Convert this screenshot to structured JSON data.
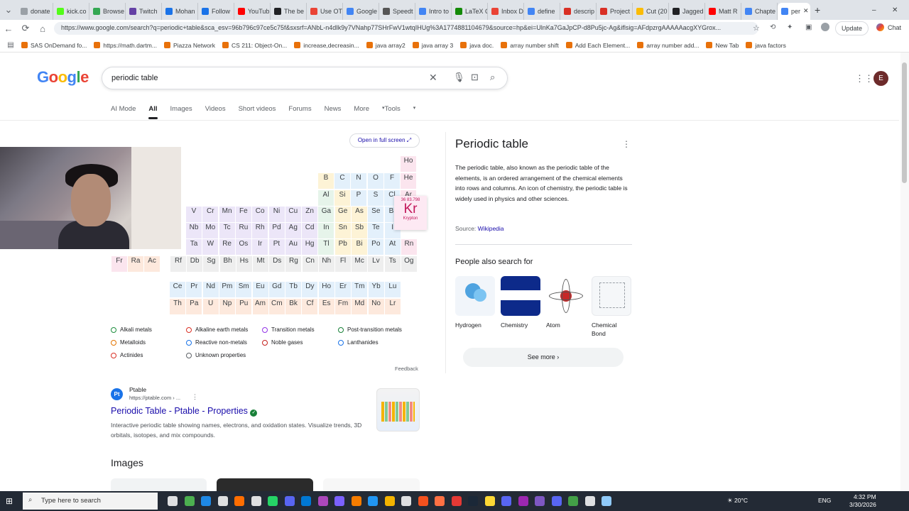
{
  "browser": {
    "tabs": [
      {
        "label": "donate"
      },
      {
        "label": "kick.co"
      },
      {
        "label": "Browse"
      },
      {
        "label": "Twitch"
      },
      {
        "label": "Mohan"
      },
      {
        "label": "Follow"
      },
      {
        "label": "YouTub"
      },
      {
        "label": "The be"
      },
      {
        "label": "Use OT"
      },
      {
        "label": "Google"
      },
      {
        "label": "Speedt"
      },
      {
        "label": "Intro to"
      },
      {
        "label": "LaTeX C"
      },
      {
        "label": "Inbox D"
      },
      {
        "label": "define"
      },
      {
        "label": "descrip"
      },
      {
        "label": "Project"
      },
      {
        "label": "Cut (20"
      },
      {
        "label": "Jagged"
      },
      {
        "label": "Matt R"
      },
      {
        "label": "Chapte"
      },
      {
        "label": "per"
      }
    ],
    "url": "https://www.google.com/search?q=periodic+table&sca_esv=96b796c97ce5c75f&sxsrf=ANbL-n4dIk9y7VNahp77SHrFwV1wtqIHUg%3A1774881104679&source=hp&ei=UlnKa7GaJpCP-d8Pu5jc-Ag&iflsig=AFdpzrgAAAAAacgXYGrox...",
    "update_label": "Update",
    "chat_label": "Chat",
    "bookmarks": [
      "SAS OnDemand fo...",
      "https://math.dartm...",
      "Piazza Network",
      "CS 211: Object-On...",
      "increase,decreasin...",
      "java array2",
      "java array 3",
      "java doc.",
      "array number shift",
      "Add Each Element...",
      "array number add...",
      "New Tab",
      "java factors"
    ]
  },
  "search": {
    "logo": "Google",
    "query": "periodic table",
    "filters": [
      "AI Mode",
      "All",
      "Images",
      "Videos",
      "Short videos",
      "Forums",
      "News",
      "More",
      "Tools"
    ],
    "avatar": "E"
  },
  "periodic": {
    "open_full": "Open in full screen",
    "popup": {
      "number": "36",
      "mass": "83.798",
      "symbol": "Kr",
      "name": "Krypton"
    },
    "rows": [
      [
        "Ho",
        "He"
      ],
      [
        "B",
        "C",
        "N",
        "O",
        "F",
        "Ne"
      ],
      [
        "Al",
        "Si",
        "P",
        "S",
        "Cl",
        "Ar"
      ],
      [
        "V",
        "Cr",
        "Mn",
        "Fe",
        "Co",
        "Ni",
        "Cu",
        "Zn",
        "Ga",
        "Ge",
        "As",
        "Se",
        "Br"
      ],
      [
        "Nb",
        "Mo",
        "Tc",
        "Ru",
        "Rh",
        "Pd",
        "Ag",
        "Cd",
        "In",
        "Sn",
        "Sb",
        "Te",
        "I"
      ],
      [
        "Ta",
        "W",
        "Re",
        "Os",
        "Ir",
        "Pt",
        "Au",
        "Hg",
        "Tl",
        "Pb",
        "Bi",
        "Po",
        "At",
        "Rn"
      ],
      [
        "Fr",
        "Ra",
        "Ac",
        "Rf",
        "Db",
        "Sg",
        "Bh",
        "Hs",
        "Mt",
        "Ds",
        "Rg",
        "Cn",
        "Nh",
        "Fl",
        "Mc",
        "Lv",
        "Ts",
        "Og"
      ],
      [
        "Ce",
        "Pr",
        "Nd",
        "Pm",
        "Sm",
        "Eu",
        "Gd",
        "Tb",
        "Dy",
        "Ho",
        "Er",
        "Tm",
        "Yb",
        "Lu"
      ],
      [
        "Th",
        "Pa",
        "U",
        "Np",
        "Pu",
        "Am",
        "Cm",
        "Bk",
        "Cf",
        "Es",
        "Fm",
        "Md",
        "No",
        "Lr"
      ]
    ],
    "legend": [
      "Alkali metals",
      "Alkaline earth metals",
      "Transition metals",
      "Post-transition metals",
      "Metalloids",
      "Reactive non-metals",
      "Noble gases",
      "Lanthanides",
      "Actinides",
      "Unknown properties"
    ],
    "legend_colors": [
      "#1e8e3e",
      "#d93025",
      "#9334e6",
      "#188038",
      "#e37400",
      "#1a73e8",
      "#c5221f",
      "#1a73e8",
      "#d93025",
      "#5f6368"
    ],
    "feedback": "Feedback"
  },
  "result": {
    "site": "Ptable",
    "url": "https://ptable.com › ...",
    "title": "Periodic Table - Ptable - Properties",
    "snippet": "Interactive periodic table showing names, electrons, and oxidation states. Visualize trends, 3D orbitals, isotopes, and mix compounds."
  },
  "images_heading": "Images",
  "knowledge": {
    "title": "Periodic table",
    "description": "The periodic table, also known as the periodic table of the elements, is an ordered arrangement of the chemical elements into rows and columns. An icon of chemistry, the periodic table is widely used in physics and other sciences.",
    "source_label": "Source:",
    "source_link": "Wikipedia",
    "people_also": "People also search for",
    "related": [
      "Hydrogen",
      "Chemistry",
      "Atom",
      "Chemical Bond"
    ],
    "see_more": "See more"
  },
  "taskbar": {
    "search_placeholder": "Type here to search",
    "weather": "20°C",
    "lang": "ENG",
    "time": "4:32 PM",
    "date": "3/30/2026"
  }
}
